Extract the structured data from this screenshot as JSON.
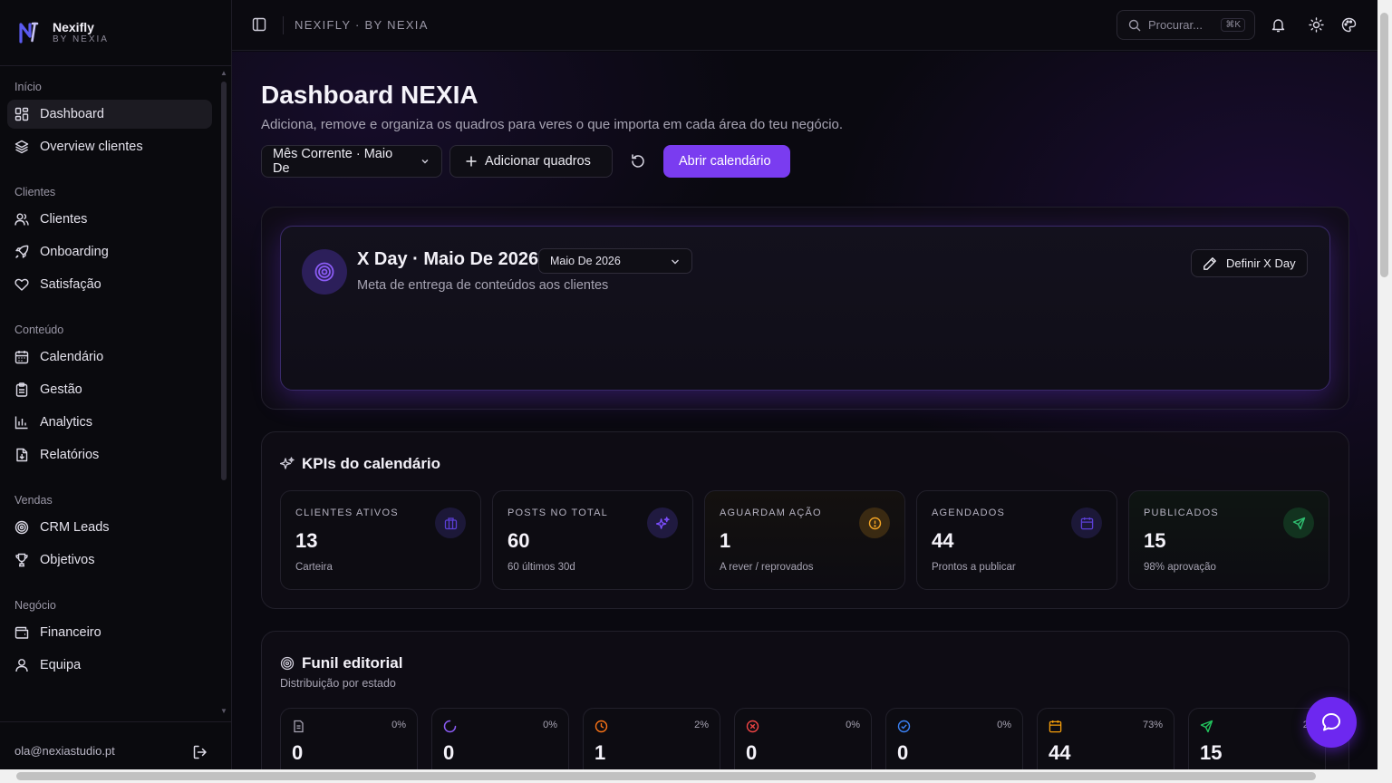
{
  "brand": {
    "name": "Nexifly",
    "sub": "BY NEXIA"
  },
  "sidebar": {
    "groups": [
      {
        "label": "Início",
        "items": [
          {
            "label": "Dashboard",
            "icon": "dashboard-icon",
            "active": true
          },
          {
            "label": "Overview clientes",
            "icon": "layers-icon"
          }
        ]
      },
      {
        "label": "Clientes",
        "items": [
          {
            "label": "Clientes",
            "icon": "users-icon"
          },
          {
            "label": "Onboarding",
            "icon": "rocket-icon"
          },
          {
            "label": "Satisfação",
            "icon": "heart-icon"
          }
        ]
      },
      {
        "label": "Conteúdo",
        "items": [
          {
            "label": "Calendário",
            "icon": "calendar-icon"
          },
          {
            "label": "Gestão",
            "icon": "clipboard-icon"
          },
          {
            "label": "Analytics",
            "icon": "bar-chart-icon"
          },
          {
            "label": "Relatórios",
            "icon": "report-icon"
          }
        ]
      },
      {
        "label": "Vendas",
        "items": [
          {
            "label": "CRM Leads",
            "icon": "target-icon"
          },
          {
            "label": "Objetivos",
            "icon": "trophy-icon"
          }
        ]
      },
      {
        "label": "Negócio",
        "items": [
          {
            "label": "Financeiro",
            "icon": "wallet-icon"
          },
          {
            "label": "Equipa",
            "icon": "user-icon"
          }
        ]
      }
    ],
    "user_email": "ola@nexiastudio.pt"
  },
  "topbar": {
    "breadcrumb": "NEXIFLY · BY NEXIA",
    "search_placeholder": "Procurar...",
    "search_kbd": "⌘K"
  },
  "page": {
    "title": "Dashboard NEXIA",
    "subtitle": "Adiciona, remove e organiza os quadros para veres o que importa em cada área do teu negócio.",
    "period_select": "Mês Corrente · Maio De",
    "add_label": "Adicionar quadros",
    "calendar_label": "Abrir calendário"
  },
  "xday": {
    "title": "X Day · Maio De 2026",
    "month": "Maio De 2026",
    "subtitle": "Meta de entrega de conteúdos aos clientes",
    "define_label": "Definir X Day"
  },
  "kpis": {
    "title": "KPIs do calendário",
    "items": [
      {
        "label": "CLIENTES ATIVOS",
        "value": "13",
        "note": "Carteira",
        "icon": "briefcase-icon",
        "color": "#5b3fd6"
      },
      {
        "label": "POSTS NO TOTAL",
        "value": "60",
        "note": "60 últimos 30d",
        "icon": "sparkles-icon",
        "color": "#7c4dff"
      },
      {
        "label": "AGUARDAM AÇÃO",
        "value": "1",
        "note": "A rever / reprovados",
        "icon": "alert-circle-icon",
        "color": "#f5a524"
      },
      {
        "label": "AGENDADOS",
        "value": "44",
        "note": "Prontos a publicar",
        "icon": "calendar-icon",
        "color": "#5b3fd6"
      },
      {
        "label": "PUBLICADOS",
        "value": "15",
        "note": "98% aprovação",
        "icon": "send-icon",
        "color": "#2fbf71"
      }
    ]
  },
  "funnel": {
    "title": "Funil editorial",
    "subtitle": "Distribuição por estado",
    "items": [
      {
        "value": "0",
        "pct": "0%",
        "icon": "document-icon",
        "color": "#a7a4b3"
      },
      {
        "value": "0",
        "pct": "0%",
        "icon": "loader-icon",
        "color": "#8b5cf6"
      },
      {
        "value": "1",
        "pct": "2%",
        "icon": "clock-icon",
        "color": "#f97316"
      },
      {
        "value": "0",
        "pct": "0%",
        "icon": "x-circle-icon",
        "color": "#ef4444"
      },
      {
        "value": "0",
        "pct": "0%",
        "icon": "check-circle-icon",
        "color": "#3b82f6"
      },
      {
        "value": "44",
        "pct": "73%",
        "icon": "calendar-icon",
        "color": "#f59e0b"
      },
      {
        "value": "15",
        "pct": "25",
        "icon": "send-icon",
        "color": "#22c55e"
      }
    ]
  }
}
